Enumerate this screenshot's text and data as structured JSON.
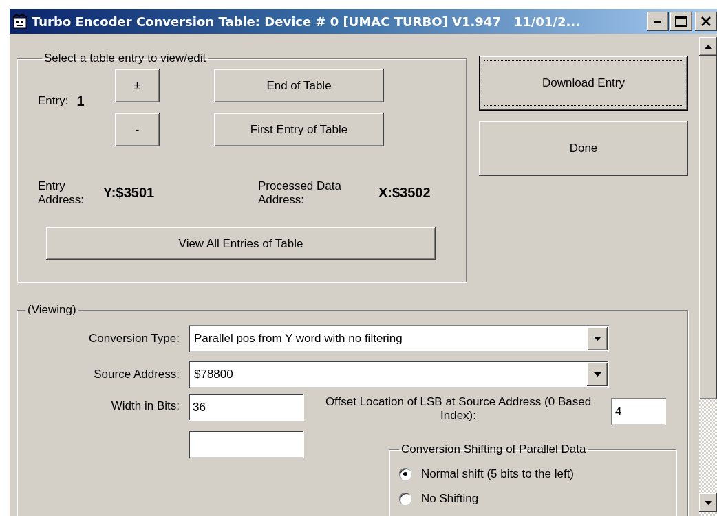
{
  "window": {
    "title": "Turbo Encoder Conversion Table: Device # 0 [UMAC TURBO] V1.947   11/01/2..."
  },
  "selection_group": {
    "legend": "Select a table entry to view/edit",
    "entry_label": "Entry:",
    "entry_value": "1",
    "increment_button": "±",
    "decrement_button": "-",
    "end_button": "End of Table",
    "first_button": "First Entry of Table",
    "entry_address_label": "Entry Address:",
    "entry_address_value": "Y:$3501",
    "processed_label": "Processed Data Address:",
    "processed_value": "X:$3502",
    "view_all_button": "View All Entries of Table"
  },
  "actions": [
    {
      "label": "Download Entry",
      "default": true
    },
    {
      "label": "Done",
      "default": false
    }
  ],
  "viewing_group": {
    "legend": "(Viewing)",
    "conversion_type": {
      "label": "Conversion Type:",
      "value": "Parallel pos from Y word with no filtering"
    },
    "source_address": {
      "label": "Source Address:",
      "value": "$78800"
    },
    "width_in_bits": {
      "label": "Width in Bits:",
      "value": "36"
    },
    "offset": {
      "label": "Offset Location of LSB at Source Address (0 Based Index):",
      "value": "4"
    },
    "shifting": {
      "legend": "Conversion Shifting of Parallel Data",
      "options": [
        {
          "label": "Normal shift (5 bits to the left)",
          "selected": true
        },
        {
          "label": "No Shifting",
          "selected": false
        }
      ]
    }
  }
}
